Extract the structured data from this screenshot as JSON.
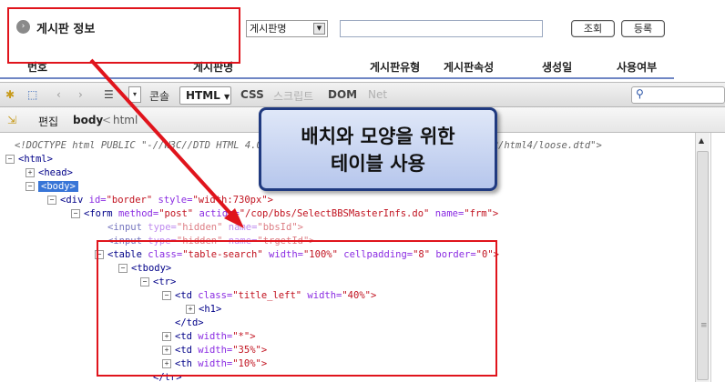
{
  "board": {
    "title": "게시판 정보",
    "title_icon": "circle-arrow-icon",
    "select_value": "게시판명",
    "search_value": "",
    "btn_search": "조회",
    "btn_register": "등록"
  },
  "table_header": {
    "col_no": "번호",
    "col_name": "게시판명",
    "col_type": "게시판유형",
    "col_attr": "게시판속성",
    "col_date": "생성일",
    "col_use": "사용여부"
  },
  "firebug": {
    "console": "콘솔",
    "html_tab": "HTML",
    "css_tab": "CSS",
    "script_tab": "스크립트",
    "dom_tab": "DOM",
    "net_tab": "Net",
    "edit": "편집",
    "bread_body": "body",
    "bread_sep": "<",
    "bread_html": "html"
  },
  "code": {
    "doctype": "<!DOCTYPE html PUBLIC \"-//W3C//DTD HTML 4.01 Transitional//EN\" \"http://www.w3.org/TR/html4/loose.dtd\">",
    "html": "<html>",
    "head": "<head>",
    "body": "<body>",
    "div_open": "<div",
    "div_attr1": "id=",
    "div_val1": "\"border\"",
    "div_attr2": "style=",
    "div_val2": "\"width:730px\">",
    "form_open": "<form",
    "form_attr1": "method=",
    "form_val1": "\"post\"",
    "form_attr2": "action=",
    "form_val2": "\"/cop/bbs/SelectBBSMasterInfs.do\"",
    "form_attr3": "name=",
    "form_val3": "\"frm\">",
    "input1_tag": "<input",
    "input1_attr1": "type=",
    "input1_val1": "\"hidden\"",
    "input1_attr2": "name=",
    "input1_val2": "\"bbsId\">",
    "input2_tag": "<input",
    "input2_attr1": "type=",
    "input2_val1": "\"hidden\"",
    "input2_attr2": "name=",
    "input2_val2": "\"trgetId\">",
    "table_tag": "<table",
    "table_attr1": "class=",
    "table_val1": "\"table-search\"",
    "table_attr2": "width=",
    "table_val2": "\"100%\"",
    "table_attr3": "cellpadding=",
    "table_val3": "\"8\"",
    "table_attr4": "border=",
    "table_val4": "\"0\">",
    "tbody": "<tbody>",
    "tr": "<tr>",
    "td1_tag": "<td",
    "td1_attr1": "class=",
    "td1_val1": "\"title_left\"",
    "td1_attr2": "width=",
    "td1_val2": "\"40%\">",
    "h1": "<h1>",
    "td_close": "</td>",
    "td2_tag": "<td",
    "td2_attr": "width=",
    "td2_val": "\"*\">",
    "td3_tag": "<td",
    "td3_attr": "width=",
    "td3_val": "\"35%\">",
    "th_tag": "<th",
    "th_attr": "width=",
    "th_val": "\"10%\">",
    "tr_close": "</tr>"
  },
  "callout": {
    "line1": "배치와 모양을 위한",
    "line2": "테이블 사용"
  },
  "colors": {
    "highlight": "#e0141c",
    "selection": "#3875d7",
    "callout_border": "#203a80"
  }
}
